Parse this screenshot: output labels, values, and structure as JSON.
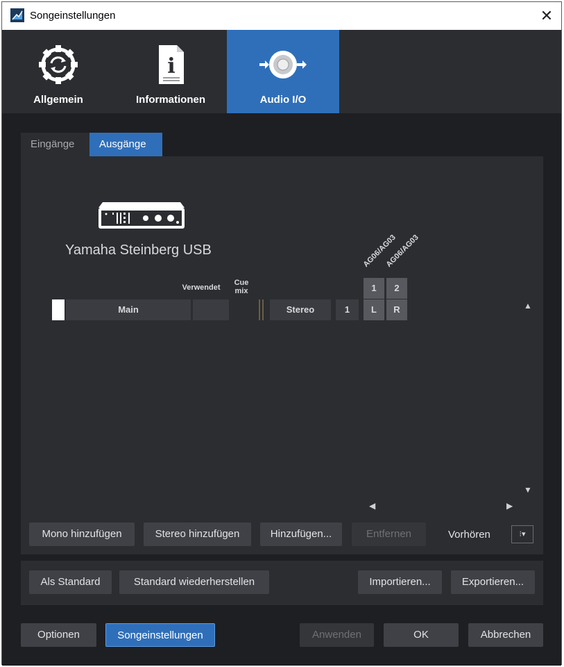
{
  "window": {
    "title": "Songeinstellungen",
    "close_glyph": "✕"
  },
  "category_tabs": [
    {
      "label": "Allgemein",
      "icon": "gear-refresh-icon",
      "active": false
    },
    {
      "label": "Informationen",
      "icon": "info-document-icon",
      "active": false
    },
    {
      "label": "Audio I/O",
      "icon": "speaker-arrows-icon",
      "active": true
    }
  ],
  "sub_tabs": [
    {
      "label": "Eingänge",
      "active": false
    },
    {
      "label": "Ausgänge",
      "active": true
    }
  ],
  "device": {
    "name": "Yamaha Steinberg USB",
    "icon": "audio-interface-icon",
    "channel_labels": [
      "AG06/AG03",
      "AG06/AG03"
    ],
    "channel_numbers": [
      "1",
      "2"
    ]
  },
  "table": {
    "col_verwendet": "Verwendet",
    "col_cue": "Cue",
    "col_mix": "mix",
    "row": {
      "name": "Main",
      "format": "Stereo",
      "count": "1",
      "left": "L",
      "right": "R"
    }
  },
  "scroll": {
    "up": "▲",
    "down": "▼",
    "left": "◀",
    "right": "▶"
  },
  "actions": {
    "mono_add": "Mono hinzufügen",
    "stereo_add": "Stereo hinzufügen",
    "add": "Hinzufügen...",
    "remove": "Entfernen",
    "preview_label": "Vorhören",
    "preview_dropdown": "⁝▾"
  },
  "defaults": {
    "as_default": "Als Standard",
    "restore_default": "Standard wiederherstellen",
    "import": "Importieren...",
    "export": "Exportieren..."
  },
  "footer": {
    "options": "Optionen",
    "song_settings": "Songeinstellungen",
    "apply": "Anwenden",
    "ok": "OK",
    "cancel": "Abbrechen"
  },
  "colors": {
    "accent": "#2f6fba",
    "background": "#1e1f22",
    "panel": "#2b2d31"
  }
}
